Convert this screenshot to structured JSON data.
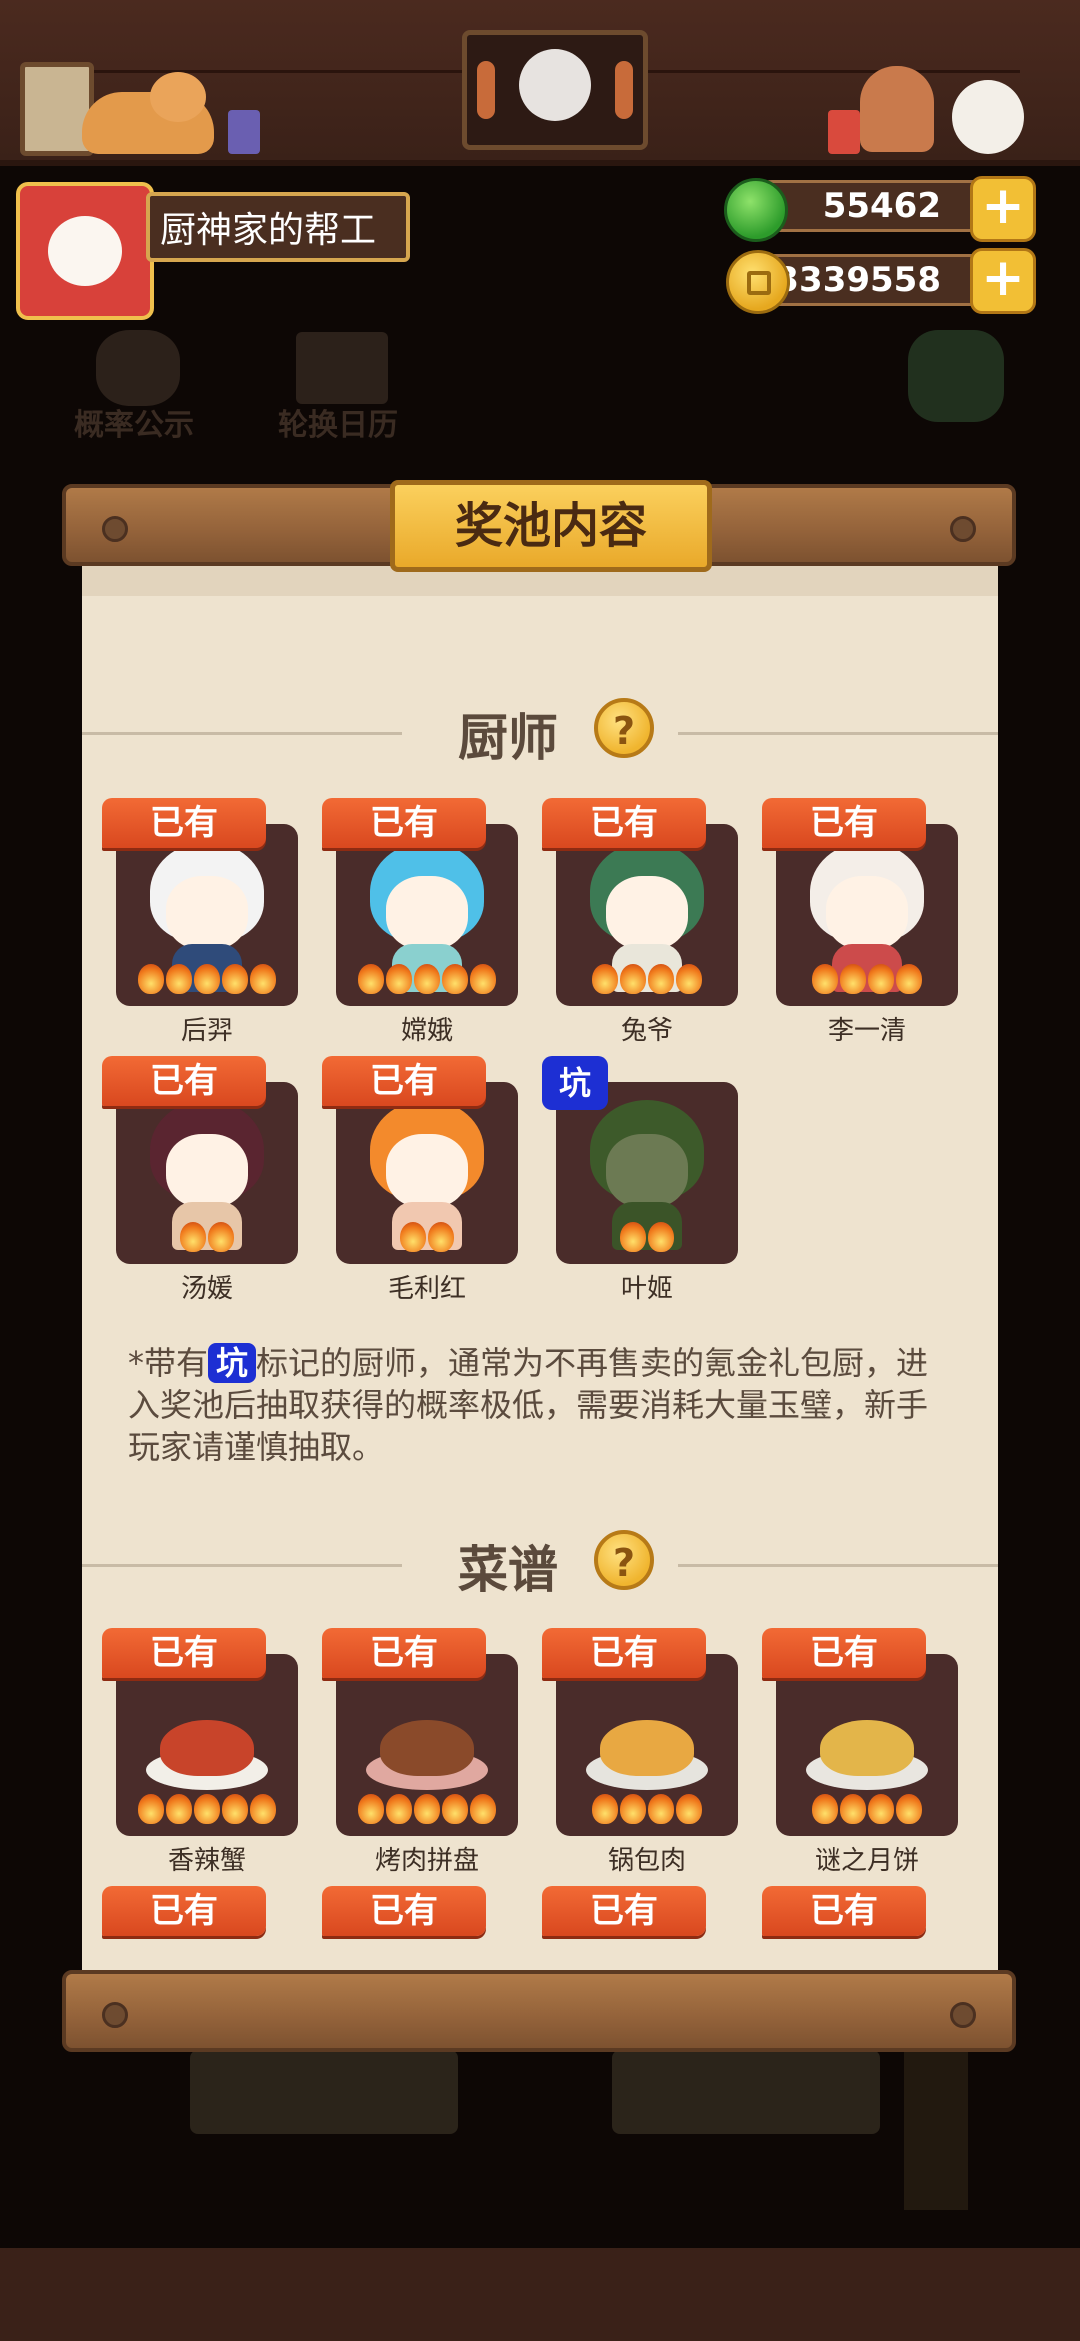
{
  "header": {
    "player_name": "厨神家的帮工",
    "jade_amount": "55462",
    "coin_amount": "23339558",
    "plus_label": "+"
  },
  "background_buttons": {
    "probability": "概率公示",
    "calendar": "轮换日历",
    "percent_glyph": "%"
  },
  "panel": {
    "title": "奖池内容",
    "chef_section": {
      "title": "厨师",
      "help": "?",
      "owned_label": "已有",
      "pit_label": "坑",
      "items": [
        {
          "name": "后羿",
          "status": "owned",
          "stars": 5
        },
        {
          "name": "嫦娥",
          "status": "owned",
          "stars": 5
        },
        {
          "name": "兔爷",
          "status": "owned",
          "stars": 4
        },
        {
          "name": "李一清",
          "status": "owned",
          "stars": 4
        },
        {
          "name": "汤媛",
          "status": "owned",
          "stars": 2
        },
        {
          "name": "毛利红",
          "status": "owned",
          "stars": 2
        },
        {
          "name": "叶姬",
          "status": "pit",
          "stars": 2
        }
      ],
      "note_prefix": "*带有",
      "note_pit": "坑",
      "note_rest": "标记的厨师，通常为不再售卖的氪金礼包厨，进入奖池后抽取获得的概率极低，需要消耗大量玉璧，新手玩家请谨慎抽取。"
    },
    "recipe_section": {
      "title": "菜谱",
      "help": "?",
      "owned_label": "已有",
      "items": [
        {
          "name": "香辣蟹",
          "status": "owned",
          "stars": 5
        },
        {
          "name": "烤肉拼盘",
          "status": "owned",
          "stars": 5
        },
        {
          "name": "锅包肉",
          "status": "owned",
          "stars": 4
        },
        {
          "name": "谜之月饼",
          "status": "owned",
          "stars": 4
        }
      ]
    }
  },
  "colors": {
    "owned_badge": "#e2552a",
    "pit_badge": "#1d2fd3",
    "paper": "#eee3cf",
    "plaque": "#f6c24a",
    "tile": "#4a2c2a"
  }
}
